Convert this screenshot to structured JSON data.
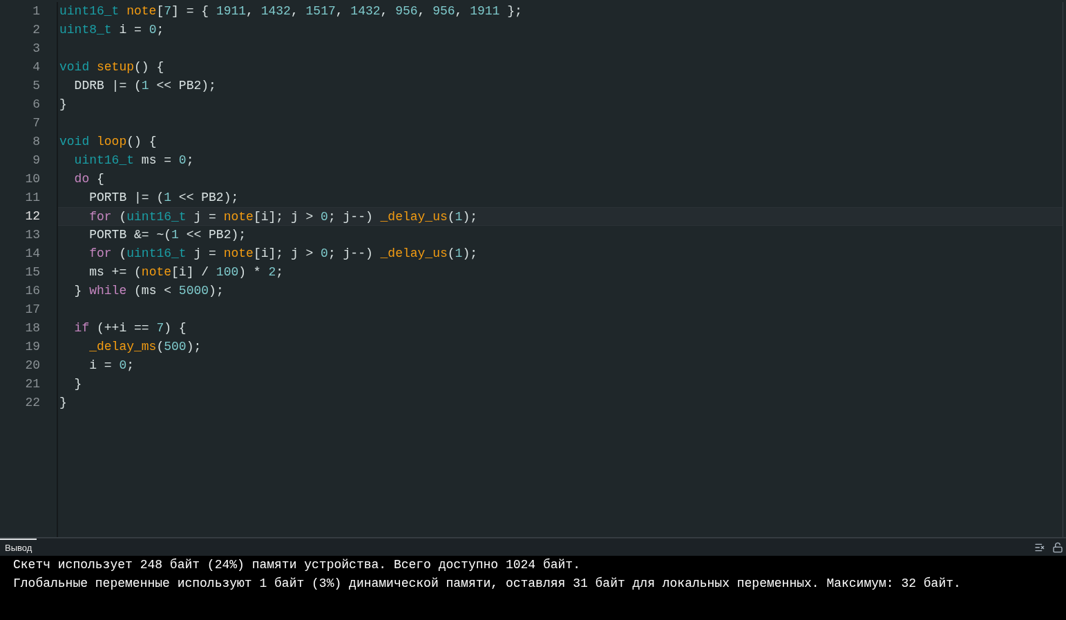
{
  "editor": {
    "lines": [
      {
        "number": "1",
        "selected": false,
        "tokens": [
          {
            "kind": "type",
            "text": "uint16_t "
          },
          {
            "kind": "fn",
            "text": "note"
          },
          {
            "kind": "plain",
            "text": "["
          },
          {
            "kind": "num",
            "text": "7"
          },
          {
            "kind": "plain",
            "text": "] = { "
          },
          {
            "kind": "num",
            "text": "1911"
          },
          {
            "kind": "plain",
            "text": ", "
          },
          {
            "kind": "num",
            "text": "1432"
          },
          {
            "kind": "plain",
            "text": ", "
          },
          {
            "kind": "num",
            "text": "1517"
          },
          {
            "kind": "plain",
            "text": ", "
          },
          {
            "kind": "num",
            "text": "1432"
          },
          {
            "kind": "plain",
            "text": ", "
          },
          {
            "kind": "num",
            "text": "956"
          },
          {
            "kind": "plain",
            "text": ", "
          },
          {
            "kind": "num",
            "text": "956"
          },
          {
            "kind": "plain",
            "text": ", "
          },
          {
            "kind": "num",
            "text": "1911"
          },
          {
            "kind": "plain",
            "text": " };"
          }
        ]
      },
      {
        "number": "2",
        "selected": false,
        "tokens": [
          {
            "kind": "type",
            "text": "uint8_t"
          },
          {
            "kind": "plain",
            "text": " i = "
          },
          {
            "kind": "num",
            "text": "0"
          },
          {
            "kind": "plain",
            "text": ";"
          }
        ]
      },
      {
        "number": "3",
        "selected": false
      },
      {
        "number": "4",
        "selected": false,
        "tokens": [
          {
            "kind": "type",
            "text": "void "
          },
          {
            "kind": "fn",
            "text": "setup"
          },
          {
            "kind": "plain",
            "text": "() {"
          }
        ]
      },
      {
        "number": "5",
        "selected": false,
        "tokens": [
          {
            "kind": "plain",
            "text": "  DDRB |= ("
          },
          {
            "kind": "num",
            "text": "1"
          },
          {
            "kind": "plain",
            "text": " << PB2);"
          }
        ]
      },
      {
        "number": "6",
        "selected": false,
        "tokens": [
          {
            "kind": "plain",
            "text": "}"
          }
        ]
      },
      {
        "number": "7",
        "selected": false
      },
      {
        "number": "8",
        "selected": false,
        "tokens": [
          {
            "kind": "type",
            "text": "void "
          },
          {
            "kind": "fn",
            "text": "loop"
          },
          {
            "kind": "plain",
            "text": "() {"
          }
        ]
      },
      {
        "number": "9",
        "selected": false,
        "tokens": [
          {
            "kind": "type",
            "text": "  uint16_t"
          },
          {
            "kind": "plain",
            "text": " ms = "
          },
          {
            "kind": "num",
            "text": "0"
          },
          {
            "kind": "plain",
            "text": ";"
          }
        ]
      },
      {
        "number": "10",
        "selected": false,
        "tokens": [
          {
            "kind": "kw",
            "text": "  do"
          },
          {
            "kind": "plain",
            "text": " {"
          }
        ]
      },
      {
        "number": "11",
        "selected": false,
        "tokens": [
          {
            "kind": "plain",
            "text": "    PORTB |= ("
          },
          {
            "kind": "num",
            "text": "1"
          },
          {
            "kind": "plain",
            "text": " << PB2);"
          }
        ]
      },
      {
        "number": "12",
        "selected": true,
        "tokens": [
          {
            "kind": "kw",
            "text": "    for"
          },
          {
            "kind": "plain",
            "text": " ("
          },
          {
            "kind": "type",
            "text": "uint16_t"
          },
          {
            "kind": "plain",
            "text": " j = "
          },
          {
            "kind": "fn",
            "text": "note"
          },
          {
            "kind": "plain",
            "text": "[i]; j > "
          },
          {
            "kind": "num",
            "text": "0"
          },
          {
            "kind": "plain",
            "text": "; j--) "
          },
          {
            "kind": "fn",
            "text": "_delay_us"
          },
          {
            "kind": "plain",
            "text": "("
          },
          {
            "kind": "num",
            "text": "1"
          },
          {
            "kind": "plain",
            "text": ");"
          }
        ]
      },
      {
        "number": "13",
        "selected": false,
        "tokens": [
          {
            "kind": "plain",
            "text": "    PORTB &= ~("
          },
          {
            "kind": "num",
            "text": "1"
          },
          {
            "kind": "plain",
            "text": " << PB2);"
          }
        ]
      },
      {
        "number": "14",
        "selected": false,
        "tokens": [
          {
            "kind": "kw",
            "text": "    for"
          },
          {
            "kind": "plain",
            "text": " ("
          },
          {
            "kind": "type",
            "text": "uint16_t"
          },
          {
            "kind": "plain",
            "text": " j = "
          },
          {
            "kind": "fn",
            "text": "note"
          },
          {
            "kind": "plain",
            "text": "[i]; j > "
          },
          {
            "kind": "num",
            "text": "0"
          },
          {
            "kind": "plain",
            "text": "; j--) "
          },
          {
            "kind": "fn",
            "text": "_delay_us"
          },
          {
            "kind": "plain",
            "text": "("
          },
          {
            "kind": "num",
            "text": "1"
          },
          {
            "kind": "plain",
            "text": ");"
          }
        ]
      },
      {
        "number": "15",
        "selected": false,
        "tokens": [
          {
            "kind": "plain",
            "text": "    ms += ("
          },
          {
            "kind": "fn",
            "text": "note"
          },
          {
            "kind": "plain",
            "text": "[i] / "
          },
          {
            "kind": "num",
            "text": "100"
          },
          {
            "kind": "plain",
            "text": ") * "
          },
          {
            "kind": "num",
            "text": "2"
          },
          {
            "kind": "plain",
            "text": ";"
          }
        ]
      },
      {
        "number": "16",
        "selected": false,
        "tokens": [
          {
            "kind": "plain",
            "text": "  } "
          },
          {
            "kind": "kw",
            "text": "while"
          },
          {
            "kind": "plain",
            "text": " (ms < "
          },
          {
            "kind": "num",
            "text": "5000"
          },
          {
            "kind": "plain",
            "text": ");"
          }
        ]
      },
      {
        "number": "17",
        "selected": false
      },
      {
        "number": "18",
        "selected": false,
        "tokens": [
          {
            "kind": "kw",
            "text": "  if"
          },
          {
            "kind": "plain",
            "text": " (++i == "
          },
          {
            "kind": "num",
            "text": "7"
          },
          {
            "kind": "plain",
            "text": ") {"
          }
        ]
      },
      {
        "number": "19",
        "selected": false,
        "tokens": [
          {
            "kind": "fn",
            "text": "    _delay_ms"
          },
          {
            "kind": "plain",
            "text": "("
          },
          {
            "kind": "num",
            "text": "500"
          },
          {
            "kind": "plain",
            "text": ");"
          }
        ]
      },
      {
        "number": "20",
        "selected": false,
        "tokens": [
          {
            "kind": "plain",
            "text": "    i = "
          },
          {
            "kind": "num",
            "text": "0"
          },
          {
            "kind": "plain",
            "text": ";"
          }
        ]
      },
      {
        "number": "21",
        "selected": false,
        "tokens": [
          {
            "kind": "plain",
            "text": "  }"
          }
        ]
      },
      {
        "number": "22",
        "selected": false,
        "tokens": [
          {
            "kind": "plain",
            "text": "}"
          }
        ]
      }
    ]
  },
  "output": {
    "tab": "Вывод",
    "lines": [
      "Скетч использует 248 байт (24%) памяти устройства. Всего доступно 1024 байт.",
      "Глобальные переменные используют 1 байт (3%) динамической памяти, оставляя 31 байт для локальных переменных. Максимум: 32 байт."
    ]
  }
}
